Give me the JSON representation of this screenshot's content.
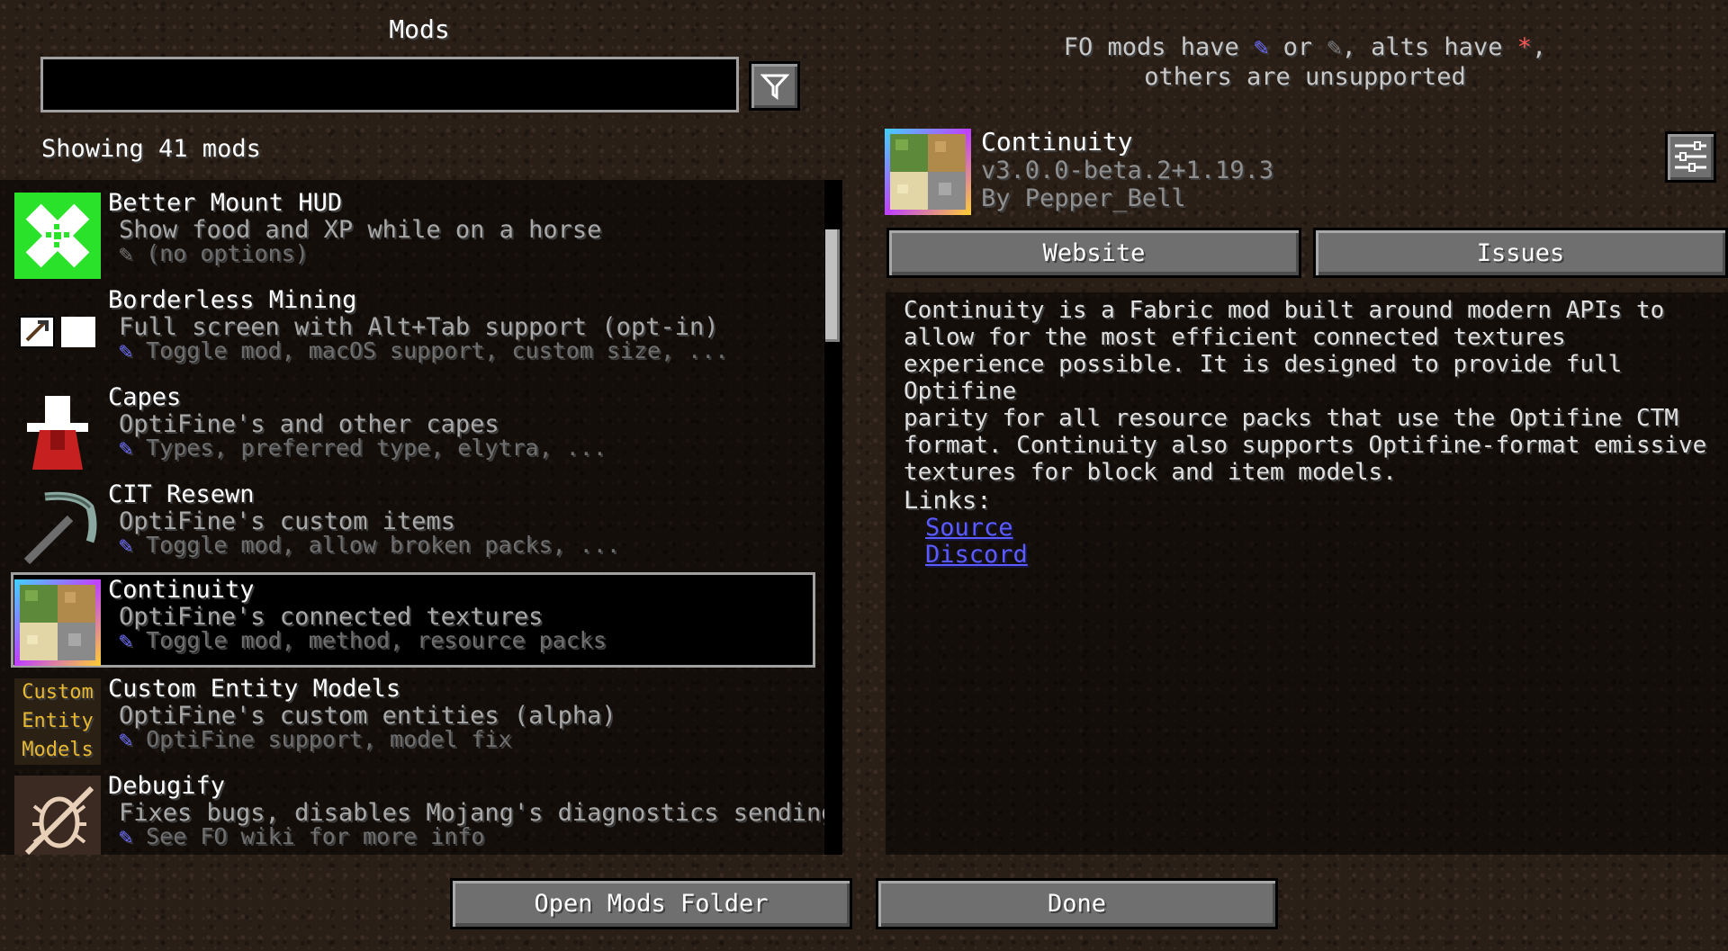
{
  "screen": {
    "title": "Mods",
    "search": {
      "value": "",
      "placeholder": ""
    },
    "filter_button_icon": "funnel-icon",
    "count_text": "Showing 41 mods"
  },
  "legend": {
    "line1_part1": "FO mods have ",
    "line1_blue_icon": "✎",
    "line1_part2": " or ",
    "line1_grey_icon": "✎",
    "line1_part3": ", alts have ",
    "line1_red_star": "*",
    "line1_part4": ",",
    "line2": "others are unsupported"
  },
  "mods": [
    {
      "name": "Better Mount HUD",
      "description": "Show food and XP while on a horse",
      "options_icon": "✎",
      "options": "(no options)",
      "icon": "bandage-icon",
      "selected": false,
      "has_config": false
    },
    {
      "name": "Borderless Mining",
      "description": "Full screen with Alt+Tab support (opt-in)",
      "options_icon": "✎",
      "options": "Toggle mod, macOS support, custom size, ...",
      "icon": "pickaxe-window-icon",
      "selected": false,
      "has_config": true
    },
    {
      "name": "Capes",
      "description": "OptiFine's and other capes",
      "options_icon": "✎",
      "options": "Types, preferred type, elytra, ...",
      "icon": "cape-icon",
      "selected": false,
      "has_config": true
    },
    {
      "name": "CIT Resewn",
      "description": "OptiFine's custom items",
      "options_icon": "✎",
      "options": "Toggle mod, allow broken packs, ...",
      "icon": "pickaxe-icon",
      "selected": false,
      "has_config": true
    },
    {
      "name": "Continuity",
      "description": "OptiFine's connected textures",
      "options_icon": "✎",
      "options": "Toggle mod, method, resource packs",
      "icon": "continuity-icon",
      "selected": true,
      "has_config": true
    },
    {
      "name": "Custom Entity Models",
      "description": "OptiFine's custom entities (alpha)",
      "options_icon": "✎",
      "options": "OptiFine support, model fix",
      "icon": "cem-text-icon",
      "icon_text": [
        "Custom",
        "Entity",
        "Models"
      ],
      "selected": false,
      "has_config": true
    },
    {
      "name": "Debugify",
      "description": "Fixes bugs, disables Mojang's diagnostics sending",
      "options_icon": "✎",
      "options": "See FO wiki for more info",
      "icon": "bug-icon",
      "selected": false,
      "has_config": true
    }
  ],
  "detail": {
    "name": "Continuity",
    "version": "v3.0.0-beta.2+1.19.3",
    "author": "By Pepper_Bell",
    "website_label": "Website",
    "issues_label": "Issues",
    "config_icon": "sliders-icon",
    "description_lines": [
      "Continuity is a Fabric mod built around modern APIs to",
      "allow for the most efficient connected textures",
      "experience possible. It is designed to provide full Optifine",
      "parity for all resource packs that use the Optifine CTM",
      "format. Continuity also supports Optifine-format emissive",
      "textures for block and item models."
    ],
    "links_label": "Links:",
    "links": [
      "Source",
      "Discord"
    ]
  },
  "footer": {
    "open_folder_label": "Open Mods Folder",
    "done_label": "Done"
  },
  "colors": {
    "configurable_icon": "#6c6cff",
    "unconfigurable_icon": "#6f6f6f",
    "alt_star": "#ff5555",
    "link": "#5b5bff"
  }
}
